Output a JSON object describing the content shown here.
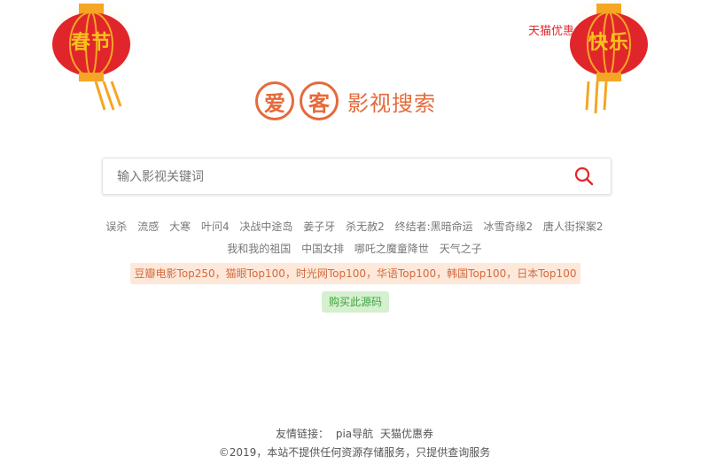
{
  "lanterns": {
    "left_text": "春节",
    "right_text": "快乐"
  },
  "top_link": "天猫优惠券",
  "logo": {
    "seal1": "爱",
    "seal2": "客",
    "text": "影视搜索"
  },
  "search": {
    "placeholder": "输入影视关键词"
  },
  "hot_keywords_row1": [
    "误杀",
    "流感",
    "大寒",
    "叶问4",
    "决战中途岛",
    "姜子牙",
    "杀无赦2",
    "终结者:黑暗命运",
    "冰雪奇缘2",
    "唐人街探案2"
  ],
  "hot_keywords_row2": [
    "我和我的祖国",
    "中国女排",
    "哪吒之魔童降世",
    "天气之子"
  ],
  "ranks_text": "豆瓣电影Top250，猫眼Top100，时光网Top100，华语Top100，韩国Top100，日本Top100",
  "buy_button": "购买此源码",
  "footer": {
    "links_label": "友情链接：",
    "links": [
      "pia导航",
      "天猫优惠券"
    ],
    "copyright": "©2019，本站不提供任何资源存储服务，只提供查询服务"
  },
  "colors": {
    "brand": "#e56a3b",
    "lantern_red": "#e0262b",
    "lantern_gold": "#f9c21c"
  }
}
